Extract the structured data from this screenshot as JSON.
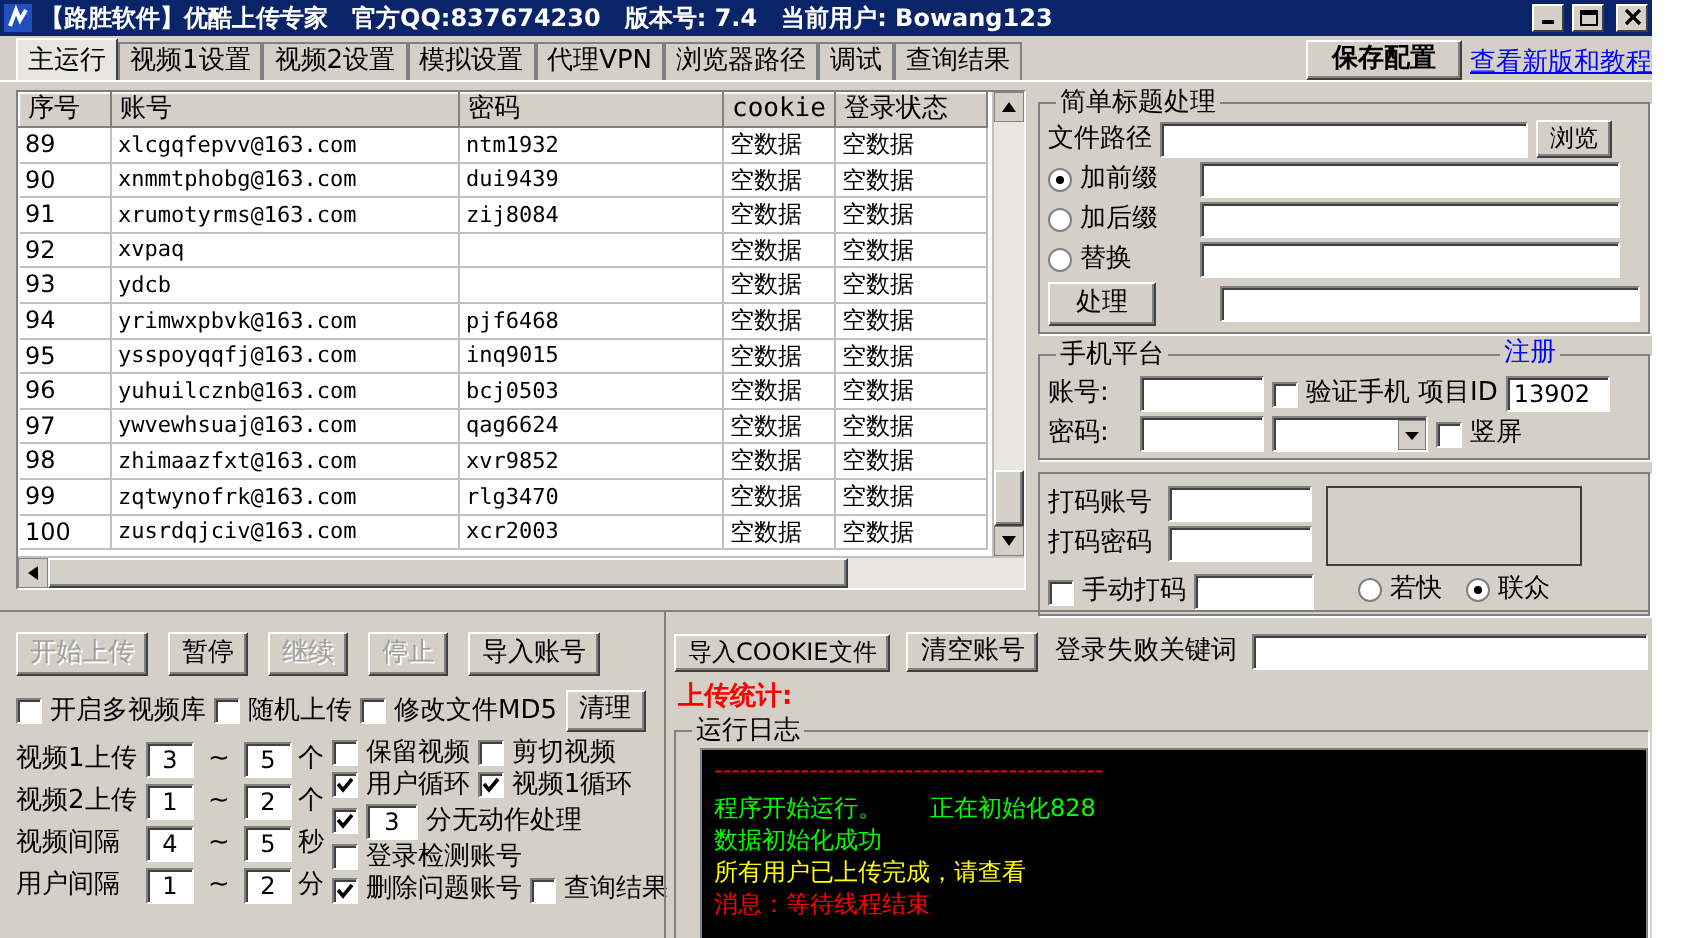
{
  "window": {
    "title": "【路胜软件】优酷上传专家　官方QQ:837674230　版本号: 7.4　当前用户: Bowang123"
  },
  "tabs": [
    {
      "label": "主运行",
      "selected": true
    },
    {
      "label": "视频1设置",
      "selected": false
    },
    {
      "label": "视频2设置",
      "selected": false
    },
    {
      "label": "模拟设置",
      "selected": false
    },
    {
      "label": "代理VPN",
      "selected": false
    },
    {
      "label": "浏览器路径",
      "selected": false
    },
    {
      "label": "调试",
      "selected": false
    },
    {
      "label": "查询结果",
      "selected": false
    }
  ],
  "save_button": "保存配置",
  "help_link": "查看新版和教程",
  "accounts": {
    "columns": [
      "序号",
      "账号",
      "密码",
      "cookie",
      "登录状态"
    ],
    "rows": [
      {
        "index": "89",
        "account": "xlcgqfepvv@163.com",
        "password": "ntm1932",
        "cookie": "空数据",
        "status": "空数据"
      },
      {
        "index": "90",
        "account": "xnmmtphobg@163.com",
        "password": "dui9439",
        "cookie": "空数据",
        "status": "空数据"
      },
      {
        "index": "91",
        "account": "xrumotyrms@163.com",
        "password": "zij8084",
        "cookie": "空数据",
        "status": "空数据"
      },
      {
        "index": "92",
        "account": "xvpaq",
        "cookie": "空数据",
        "status": "空数据"
      },
      {
        "index": "93",
        "account": "ydcb",
        "cookie": "空数据",
        "status": "空数据"
      },
      {
        "index": "94",
        "account": "yrimwxpbvk@163.com",
        "password": "pjf6468",
        "cookie": "空数据",
        "status": "空数据"
      },
      {
        "index": "95",
        "account": "ysspoyqqfj@163.com",
        "password": "inq9015",
        "cookie": "空数据",
        "status": "空数据"
      },
      {
        "index": "96",
        "account": "yuhuilcznb@163.com",
        "password": "bcj0503",
        "cookie": "空数据",
        "status": "空数据"
      },
      {
        "index": "97",
        "account": "ywvewhsuaj@163.com",
        "password": "qag6624",
        "cookie": "空数据",
        "status": "空数据"
      },
      {
        "index": "98",
        "account": "zhimaazfxt@163.com",
        "password": "xvr9852",
        "cookie": "空数据",
        "status": "空数据"
      },
      {
        "index": "99",
        "account": "zqtwynofrk@163.com",
        "password": "rlg3470",
        "cookie": "空数据",
        "status": "空数据"
      },
      {
        "index": "100",
        "account": "zusrdqjciv@163.com",
        "password": "xcr2003",
        "cookie": "空数据",
        "status": "空数据"
      }
    ]
  },
  "title_processing": {
    "legend": "简单标题处理",
    "file_path_label": "文件路径",
    "browse_button": "浏览",
    "options": [
      {
        "label": "加前缀",
        "selected": true
      },
      {
        "label": "加后缀",
        "selected": false
      },
      {
        "label": "替换",
        "selected": false
      }
    ],
    "process_button": "处理"
  },
  "phone_platform": {
    "legend": "手机平台",
    "register_link": "注册",
    "account_label": "账号:",
    "password_label": "密码:",
    "verify_phone": {
      "label": "验证手机",
      "checked": false
    },
    "project_id_label": "项目ID",
    "project_id": "13902",
    "portrait": {
      "label": "竖屏",
      "checked": false
    }
  },
  "captcha": {
    "account_label": "打码账号",
    "password_label": "打码密码",
    "manual": {
      "label": "手动打码",
      "checked": false
    },
    "services": [
      {
        "label": "若快",
        "selected": false
      },
      {
        "label": "联众",
        "selected": true
      }
    ]
  },
  "actions": [
    {
      "label": "开始上传",
      "disabled": true
    },
    {
      "label": "暂停",
      "disabled": false
    },
    {
      "label": "继续",
      "disabled": true
    },
    {
      "label": "停止",
      "disabled": true
    },
    {
      "label": "导入账号",
      "disabled": false
    }
  ],
  "options_row": [
    {
      "label": "开启多视频库",
      "checked": false
    },
    {
      "label": "随机上传",
      "checked": false
    }
  ],
  "md5": {
    "label": "修改文件MD5",
    "checked": false
  },
  "clean_button": "清理",
  "intervals": [
    {
      "label": "视频1上传",
      "from": "3",
      "separator": "~",
      "to": "5",
      "unit": "个"
    },
    {
      "label": "视频2上传",
      "from": "1",
      "separator": "~",
      "to": "2",
      "unit": "个"
    },
    {
      "label": "视频间隔",
      "from": "4",
      "separator": "~",
      "to": "5",
      "unit": "秒"
    },
    {
      "label": "用户间隔",
      "from": "1",
      "separator": "~",
      "to": "2",
      "unit": "分"
    }
  ],
  "settings": [
    [
      {
        "kind": "checkbox",
        "label": "保留视频",
        "checked": false
      },
      {
        "kind": "checkbox",
        "label": "剪切视频",
        "checked": false
      }
    ],
    [
      {
        "kind": "checkbox",
        "label": "用户循环",
        "checked": true
      },
      {
        "kind": "checkbox",
        "label": "视频1循环",
        "checked": true
      }
    ],
    [
      {
        "kind": "checkbox",
        "checked": true
      },
      {
        "kind": "number",
        "value": "3"
      },
      {
        "kind": "text",
        "label": "分无动作处理"
      }
    ],
    [
      {
        "kind": "checkbox",
        "label": "登录检测账号",
        "checked": false
      }
    ],
    [
      {
        "kind": "checkbox",
        "label": "删除问题账号",
        "checked": true
      },
      {
        "kind": "checkbox",
        "label": "查询结果",
        "checked": false
      }
    ]
  ],
  "import_cookie_button": "导入COOKIE文件",
  "clear_accounts_button": "清空账号",
  "login_fail_keyword_label": "登录失败关键词",
  "upload_stats_label": "上传统计:",
  "log": {
    "legend": "运行日志",
    "lines": [
      {
        "text": "---------------------------------------------",
        "color": "#ff0000"
      },
      {
        "text": "程序开始运行。　　正在初始化828",
        "color": "#00ff00"
      },
      {
        "text": "数据初始化成功",
        "color": "#00ff00"
      },
      {
        "text": "所有用户已上传完成，请查看",
        "color": "#ffff00"
      },
      {
        "text": "消息：等待线程结束",
        "color": "#ff0000"
      }
    ]
  }
}
